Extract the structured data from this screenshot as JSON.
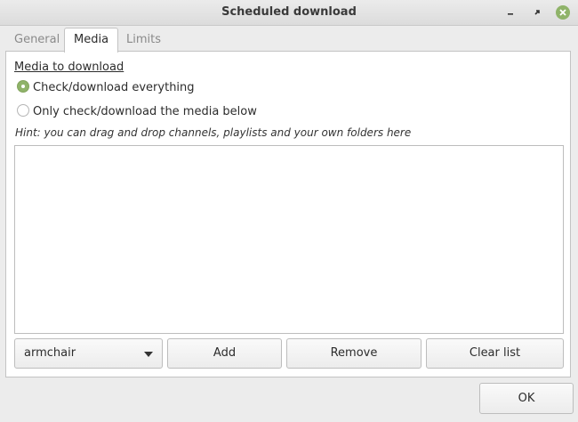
{
  "window": {
    "title": "Scheduled download",
    "accent_color": "#8fb369",
    "buttons": [
      "minimize-icon",
      "maximize-icon",
      "close-icon"
    ]
  },
  "tabs": [
    {
      "label": "General",
      "active": false
    },
    {
      "label": "Media",
      "active": true
    },
    {
      "label": "Limits",
      "active": false
    }
  ],
  "media": {
    "section_title": "Media to download",
    "options": [
      {
        "label": "Check/download everything",
        "selected": true
      },
      {
        "label": "Only check/download the media below",
        "selected": false
      }
    ],
    "hint": "Hint: you can drag and drop channels, playlists and your own folders here",
    "list_items": []
  },
  "controls": {
    "combo_value": "armchair",
    "add_label": "Add",
    "remove_label": "Remove",
    "clear_label": "Clear list"
  },
  "footer": {
    "ok_label": "OK"
  }
}
